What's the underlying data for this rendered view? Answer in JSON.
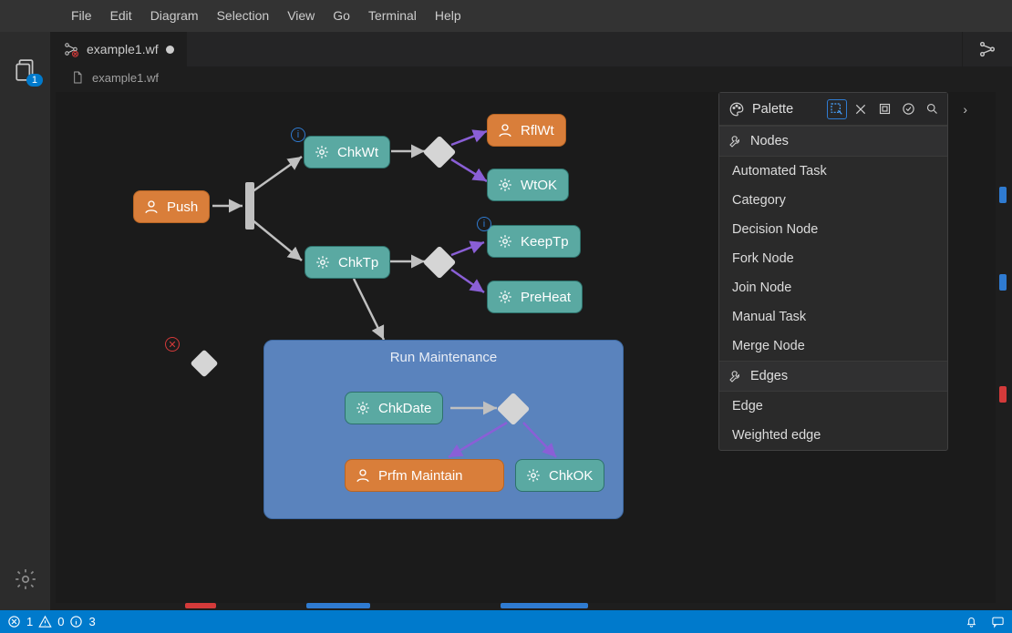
{
  "menu": {
    "file": "File",
    "edit": "Edit",
    "diagram": "Diagram",
    "selection": "Selection",
    "view": "View",
    "go": "Go",
    "terminal": "Terminal",
    "help": "Help"
  },
  "activity": {
    "explorer_badge": "1"
  },
  "tab": {
    "filename": "example1.wf"
  },
  "breadcrumb": {
    "filename": "example1.wf"
  },
  "nodes": {
    "push": "Push",
    "chkwt": "ChkWt",
    "chktp": "ChkTp",
    "rflwt": "RflWt",
    "wtok": "WtOK",
    "keeptp": "KeepTp",
    "preheat": "PreHeat",
    "run_maintenance": "Run Maintenance",
    "chkdate": "ChkDate",
    "prfm_maintain": "Prfm Maintain",
    "chkok": "ChkOK"
  },
  "info_badge": "i",
  "error_badge": "✕",
  "palette": {
    "title": "Palette",
    "nodes_header": "Nodes",
    "edges_header": "Edges",
    "items_nodes": [
      "Automated Task",
      "Category",
      "Decision Node",
      "Fork Node",
      "Join Node",
      "Manual Task",
      "Merge Node"
    ],
    "items_edges": [
      "Edge",
      "Weighted edge"
    ],
    "chevron": "›"
  },
  "status": {
    "errors": "1",
    "warnings": "0",
    "infos": "3"
  }
}
